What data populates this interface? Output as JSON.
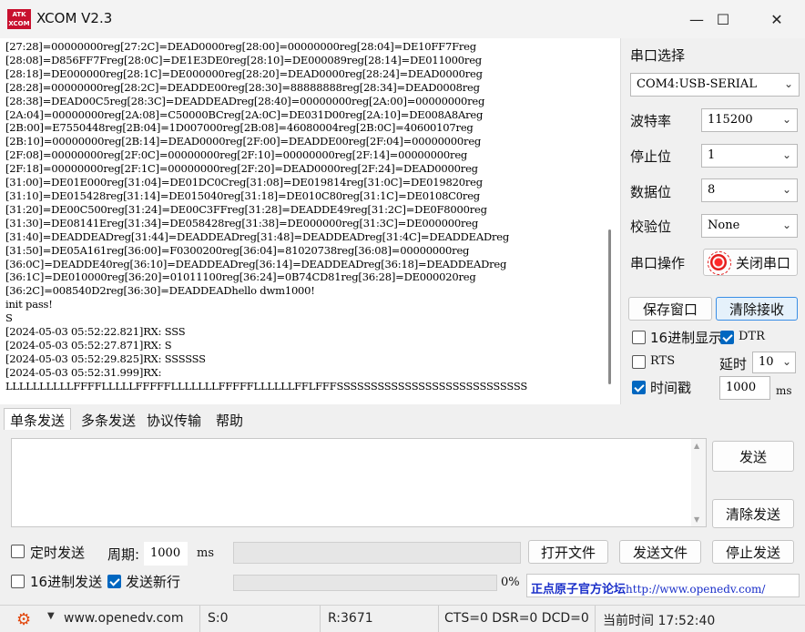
{
  "window": {
    "logo_text": "ATK XCOM",
    "title": "XCOM V2.3",
    "minimize": "—",
    "maximize": "☐",
    "close": "✕"
  },
  "receive": {
    "lines": [
      "[27:28]=00000000reg[27:2C]=DEAD0000reg[28:00]=00000000reg[28:04]=DE10FF7Freg",
      "[28:08]=D856FF7Freg[28:0C]=DE1E3DE0reg[28:10]=DE000089reg[28:14]=DE011000reg",
      "[28:18]=DE000000reg[28:1C]=DE000000reg[28:20]=DEAD0000reg[28:24]=DEAD0000reg",
      "[28:28]=00000000reg[28:2C]=DEADDE00reg[28:30]=88888888reg[28:34]=DEAD0008reg",
      "[28:38]=DEAD00C5reg[28:3C]=DEADDEADreg[28:40]=00000000reg[2A:00]=00000000reg",
      "[2A:04]=00000000reg[2A:08]=C50000BCreg[2A:0C]=DE031D00reg[2A:10]=DE008A8Areg",
      "[2B:00]=E7550448reg[2B:04]=1D007000reg[2B:08]=46080004reg[2B:0C]=40600107reg",
      "[2B:10]=00000000reg[2B:14]=DEAD0000reg[2F:00]=DEADDE00reg[2F:04]=00000000reg",
      "[2F:08]=00000000reg[2F:0C]=00000000reg[2F:10]=00000000reg[2F:14]=00000000reg",
      "[2F:18]=00000000reg[2F:1C]=00000000reg[2F:20]=DEAD0000reg[2F:24]=DEAD0000reg",
      "[31:00]=DE01E000reg[31:04]=DE01DC0Creg[31:08]=DE019814reg[31:0C]=DE019820reg",
      "[31:10]=DE015428reg[31:14]=DE015040reg[31:18]=DE010C80reg[31:1C]=DE0108C0reg",
      "[31:20]=DE00C500reg[31:24]=DE00C3FFreg[31:28]=DEADDE49reg[31:2C]=DE0F8000reg",
      "[31:30]=DE08141Ereg[31:34]=DE058428reg[31:38]=DE000000reg[31:3C]=DE000000reg",
      "[31:40]=DEADDEADreg[31:44]=DEADDEADreg[31:48]=DEADDEADreg[31:4C]=DEADDEADreg",
      "[31:50]=DE05A161reg[36:00]=F0300200reg[36:04]=81020738reg[36:08]=00000000reg",
      "[36:0C]=DEADDE40reg[36:10]=DEADDEADreg[36:14]=DEADDEADreg[36:18]=DEADDEADreg",
      "[36:1C]=DE010000reg[36:20]=01011100reg[36:24]=0B74CD81reg[36:28]=DE000020reg",
      "[36:2C]=008540D2reg[36:30]=DEADDEADhello dwm1000!",
      "init pass!",
      "S",
      "[2024-05-03 05:52:22.821]RX: SSS",
      "[2024-05-03 05:52:27.871]RX: S",
      "[2024-05-03 05:52:29.825]RX: SSSSSS",
      "[2024-05-03 05:52:31.999]RX:",
      "LLLLLLLLLLFFFFLLLLLFFFFFLLLLLLLFFFFFLLLLLLFFLFFFSSSSSSSSSSSSSSSSSSSSSSSSSSSS"
    ]
  },
  "panel": {
    "port_select_label": "串口选择",
    "port_value": "COM4:USB-SERIAL",
    "baud_label": "波特率",
    "baud_value": "115200",
    "stopbits_label": "停止位",
    "stopbits_value": "1",
    "databits_label": "数据位",
    "databits_value": "8",
    "parity_label": "校验位",
    "parity_value": "None",
    "port_op_label": "串口操作",
    "close_port_label": "关闭串口",
    "save_window_label": "保存窗口",
    "clear_receive_label": "清除接收",
    "hex_display_label": "16进制显示",
    "dtr_label": "DTR",
    "rts_label": "RTS",
    "delay_label": "延时",
    "delay_value": "10",
    "timestamp_label": "时间戳",
    "timestamp_value": "1000",
    "ms_label": "ms"
  },
  "tabs": [
    "单条发送",
    "多条发送",
    "协议传输",
    "帮助"
  ],
  "send": {
    "send_label": "发送",
    "clear_send_label": "清除发送",
    "timed_send_label": "定时发送",
    "period_label": "周期:",
    "period_value": "1000",
    "ms_label": "ms",
    "open_file_label": "打开文件",
    "send_file_label": "发送文件",
    "stop_send_label": "停止发送",
    "hex_send_label": "16进制发送",
    "send_newline_label": "发送新行",
    "progress_percent": "0%",
    "forum_text": "正点原子官方论坛",
    "forum_url": "http://www.openedv.com/"
  },
  "status": {
    "site": "www.openedv.com",
    "sent": "S:0",
    "received": "R:3671",
    "signals": "CTS=0 DSR=0 DCD=0",
    "time": "当前时间 17:52:40"
  },
  "colors": {
    "accent": "#0067c0",
    "link": "#1a2fc9",
    "logo": "#c8102e",
    "led": "#e31b1b"
  }
}
